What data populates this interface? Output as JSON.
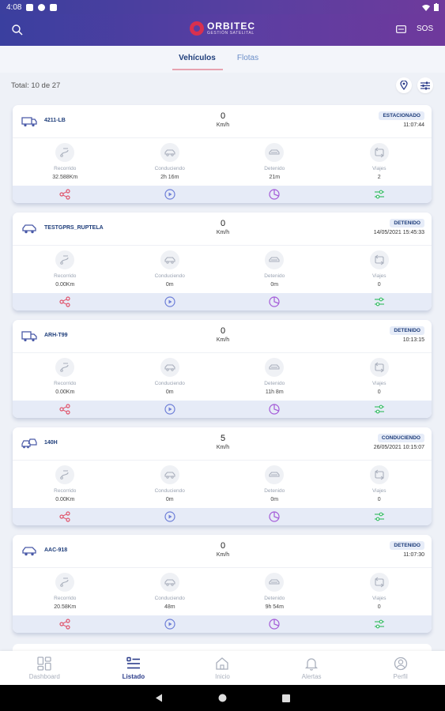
{
  "status_bar": {
    "time": "4:08"
  },
  "app_bar": {
    "logo_title": "ORBITEC",
    "logo_subtitle": "GESTIÓN SATELITAL",
    "sos_label": "SOS"
  },
  "tabs": [
    {
      "label": "Vehículos",
      "active": true
    },
    {
      "label": "Flotas",
      "active": false
    }
  ],
  "total_label": "Total: 10 de 27",
  "stat_labels": {
    "recorrido": "Recorrido",
    "conduciendo": "Conduciendo",
    "detenido": "Detenido",
    "viajes": "Viajes"
  },
  "vehicles": [
    {
      "plate": "4211-LB",
      "icon": "van-icon",
      "speed": "0",
      "unit": "Km/h",
      "status": "ESTACIONADO",
      "time": "11:07:44",
      "recorrido": "32.588Km",
      "conduciendo": "2h 16m",
      "detenido": "21m",
      "viajes": "2"
    },
    {
      "plate": "TESTGPRS_RUPTELA",
      "icon": "car-icon",
      "speed": "0",
      "unit": "Km/h",
      "status": "DETENIDO",
      "time": "14/05/2021 15:45:33",
      "recorrido": "0.00Km",
      "conduciendo": "0m",
      "detenido": "0m",
      "viajes": "0"
    },
    {
      "plate": "ARH-T99",
      "icon": "truck-icon",
      "speed": "0",
      "unit": "Km/h",
      "status": "DETENIDO",
      "time": "10:13:15",
      "recorrido": "0.00Km",
      "conduciendo": "0m",
      "detenido": "11h 8m",
      "viajes": "0"
    },
    {
      "plate": "140H",
      "icon": "cars-icon",
      "speed": "5",
      "unit": "Km/h",
      "status": "CONDUCIENDO",
      "time": "26/05/2021 10:15:07",
      "recorrido": "0.00Km",
      "conduciendo": "0m",
      "detenido": "0m",
      "viajes": "0"
    },
    {
      "plate": "AAC-918",
      "icon": "car-icon",
      "speed": "0",
      "unit": "Km/h",
      "status": "DETENIDO",
      "time": "11:07:30",
      "recorrido": "20.58Km",
      "conduciendo": "48m",
      "detenido": "9h 54m",
      "viajes": "0"
    }
  ],
  "bottom_nav": [
    {
      "label": "Dashboard",
      "icon": "dashboard-icon",
      "active": false
    },
    {
      "label": "Listado",
      "icon": "list-icon",
      "active": true
    },
    {
      "label": "Inicio",
      "icon": "home-icon",
      "active": false
    },
    {
      "label": "Alertas",
      "icon": "bell-icon",
      "active": false
    },
    {
      "label": "Perfil",
      "icon": "profile-icon",
      "active": false
    }
  ],
  "colors": {
    "brand_start": "#3a3f9f",
    "brand_end": "#6f399c",
    "share": "#e0536b",
    "play": "#6e7fd8",
    "chart": "#a45bd8",
    "filter": "#3fbf6b"
  }
}
